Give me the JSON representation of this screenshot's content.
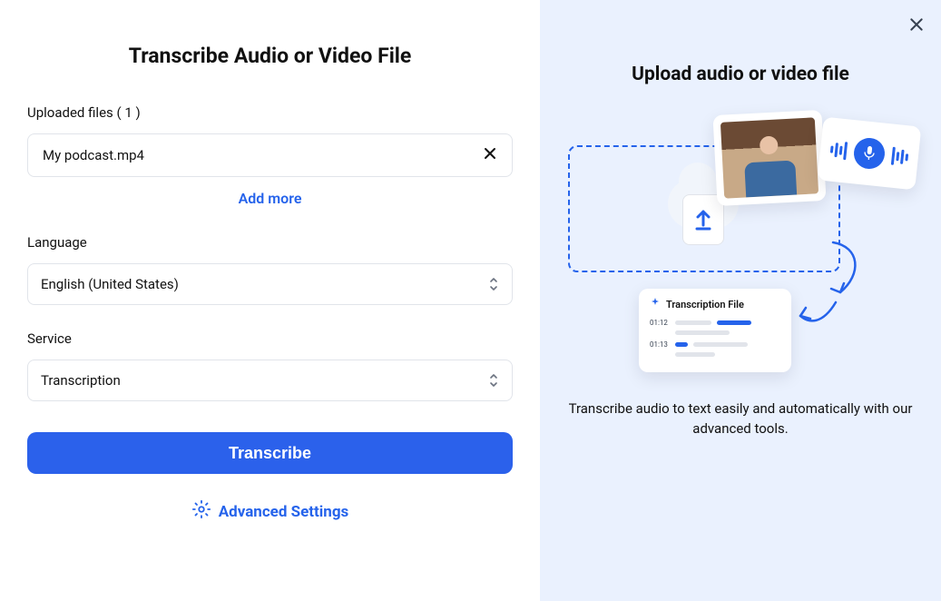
{
  "left": {
    "title": "Transcribe Audio or Video File",
    "uploaded_label": "Uploaded files ( 1 )",
    "files": [
      {
        "name": "My podcast.mp4"
      }
    ],
    "add_more_label": "Add more",
    "language_label": "Language",
    "language_value": "English (United States)",
    "service_label": "Service",
    "service_value": "Transcription",
    "transcribe_button_label": "Transcribe",
    "advanced_label": "Advanced Settings"
  },
  "right": {
    "title": "Upload audio or video file",
    "description": "Transcribe audio to text easily and automatically with our advanced tools.",
    "illustration": {
      "transcription_card_title": "Transcription File",
      "timestamps": [
        "01:12",
        "01:13"
      ]
    }
  }
}
